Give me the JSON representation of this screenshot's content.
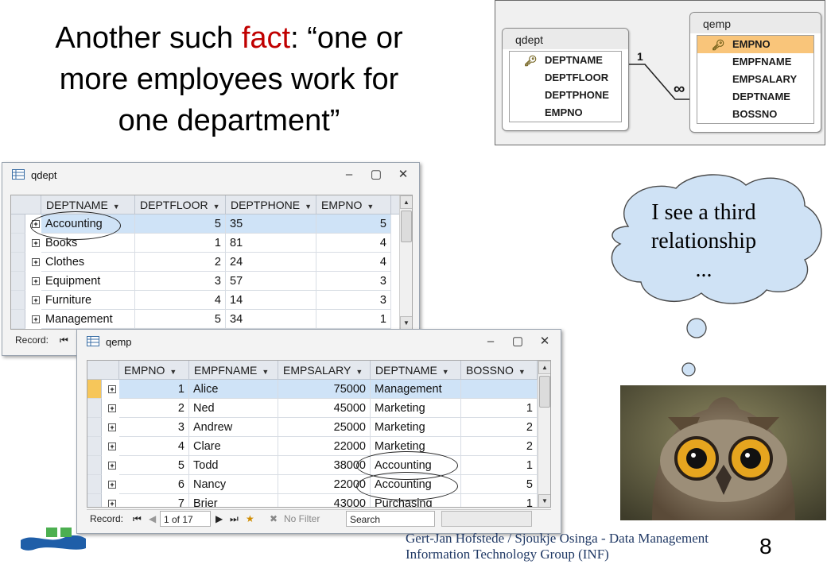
{
  "slide": {
    "title_lines": [
      {
        "pre": "Another such ",
        "hl": "fact",
        "post": ": “one or"
      },
      {
        "text": "more employees work for"
      },
      {
        "text": "one department”"
      }
    ],
    "accent_color": "#c00000",
    "page_number": "8",
    "credit_line1": "Gert-Jan Hofstede / Sjoukje Osinga - Data Management",
    "credit_line2": "Information Technology Group (INF)"
  },
  "relationship": {
    "left_table": {
      "name": "qdept",
      "fields": [
        "DEPTNAME",
        "DEPTFLOOR",
        "DEPTPHONE",
        "EMPNO"
      ]
    },
    "right_table": {
      "name": "qemp",
      "fields": [
        "EMPNO",
        "EMPFNAME",
        "EMPSALARY",
        "DEPTNAME",
        "BOSSNO"
      ]
    },
    "one_label": "1",
    "many_label": "∞"
  },
  "qdept_window": {
    "title": "qdept",
    "columns": [
      "DEPTNAME",
      "DEPTFLOOR",
      "DEPTPHONE",
      "EMPNO",
      ""
    ],
    "rows": [
      {
        "deptname": "Accounting",
        "floor": "5",
        "phone": "35",
        "empno": "5"
      },
      {
        "deptname": "Books",
        "floor": "1",
        "phone": "81",
        "empno": "4"
      },
      {
        "deptname": "Clothes",
        "floor": "2",
        "phone": "24",
        "empno": "4"
      },
      {
        "deptname": "Equipment",
        "floor": "3",
        "phone": "57",
        "empno": "3"
      },
      {
        "deptname": "Furniture",
        "floor": "4",
        "phone": "14",
        "empno": "3"
      },
      {
        "deptname": "Management",
        "floor": "5",
        "phone": "34",
        "empno": "1"
      }
    ],
    "record_label": "Record:"
  },
  "qemp_window": {
    "title": "qemp",
    "columns": [
      "EMPNO",
      "EMPFNAME",
      "EMPSALARY",
      "DEPTNAME",
      "BOSSNO"
    ],
    "rows": [
      {
        "empno": "1",
        "fname": "Alice",
        "salary": "75000",
        "dept": "Management",
        "boss": ""
      },
      {
        "empno": "2",
        "fname": "Ned",
        "salary": "45000",
        "dept": "Marketing",
        "boss": "1"
      },
      {
        "empno": "3",
        "fname": "Andrew",
        "salary": "25000",
        "dept": "Marketing",
        "boss": "2"
      },
      {
        "empno": "4",
        "fname": "Clare",
        "salary": "22000",
        "dept": "Marketing",
        "boss": "2"
      },
      {
        "empno": "5",
        "fname": "Todd",
        "salary": "38000",
        "dept": "Accounting",
        "boss": "1"
      },
      {
        "empno": "6",
        "fname": "Nancy",
        "salary": "22000",
        "dept": "Accounting",
        "boss": "5"
      },
      {
        "empno": "7",
        "fname": "Brier",
        "salary": "43000",
        "dept": "Purchasing",
        "boss": "1"
      }
    ],
    "record_label": "Record:",
    "record_position": "1 of 17",
    "filter_label": "No Filter",
    "search_label": "Search"
  },
  "bubble": {
    "lines": [
      "I see a third",
      "relationship",
      "..."
    ]
  }
}
